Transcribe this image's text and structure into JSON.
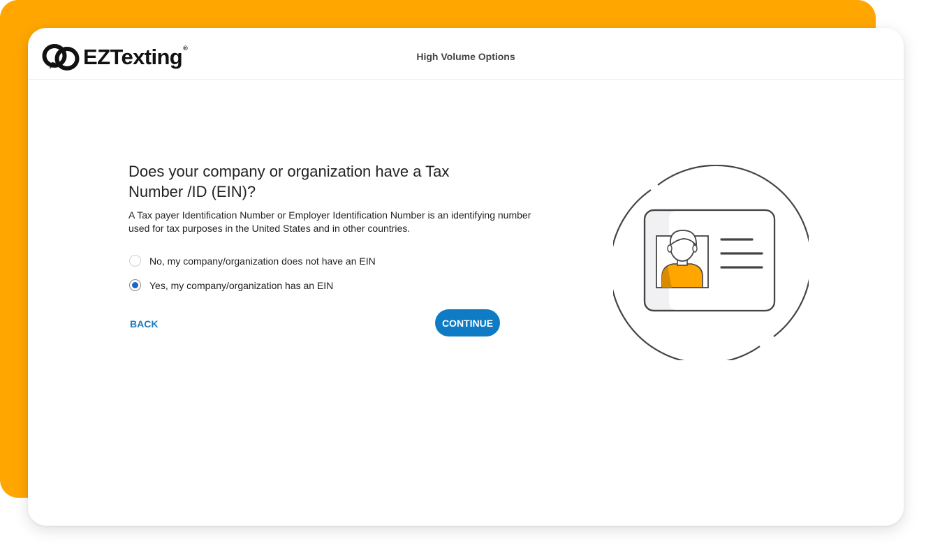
{
  "header": {
    "logo_text": "EZTexting",
    "logo_reg": "®",
    "title": "High Volume Options"
  },
  "form": {
    "question": "Does your company or organization have a Tax Number /ID (EIN)?",
    "description": "A Tax payer Identification Number or Employer Identification Number is an identifying number used for tax purposes in the United States and in other countries.",
    "options": [
      {
        "label": "No, my company/organization does not have an EIN",
        "selected": false
      },
      {
        "label": "Yes, my company/organization has an EIN",
        "selected": true
      }
    ],
    "back_label": "BACK",
    "continue_label": "CONTINUE"
  },
  "colors": {
    "accent_orange": "#ffa600",
    "primary_blue": "#0e7bc4",
    "link_blue": "#1a7bc0",
    "radio_selected": "#1668c9"
  },
  "icons": {
    "logo": "chain-link-logo-icon",
    "illustration": "id-card-icon"
  }
}
